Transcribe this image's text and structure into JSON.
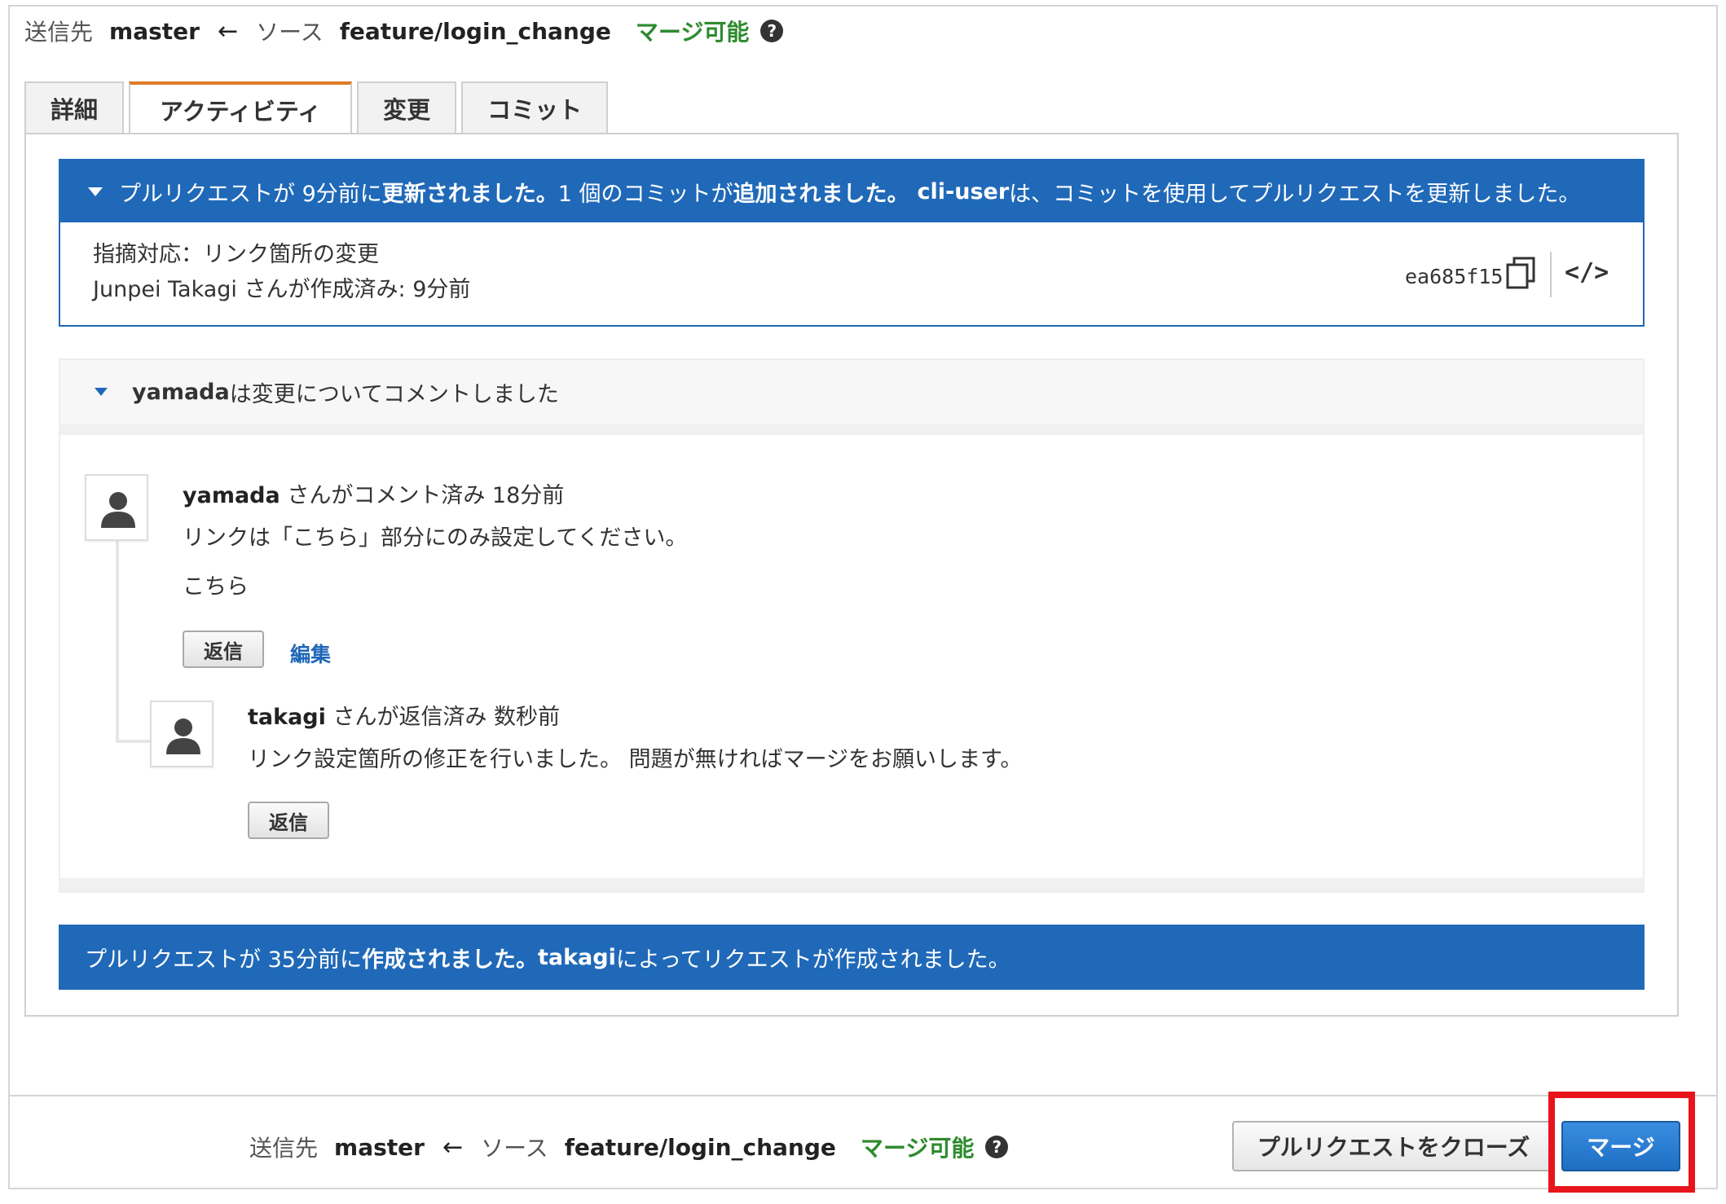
{
  "top_branch": {
    "dest_label": "送信先",
    "dest_branch": "master",
    "arrow": "←",
    "source_label": "ソース",
    "source_branch": "feature/login_change",
    "merge_status": "マージ可能",
    "help": "?"
  },
  "tabs": [
    {
      "label": "詳細"
    },
    {
      "label": "アクティビティ"
    },
    {
      "label": "変更"
    },
    {
      "label": "コミット"
    }
  ],
  "update_event": {
    "part1": "プルリクエストが 9分前に",
    "bold1": "更新されました。",
    "part2": "1 個のコミットが",
    "bold2": "追加されました。",
    "user": "cli-user",
    "part3": " は、コミットを使用してプルリクエストを更新しました。"
  },
  "commit": {
    "message": "指摘対応：リンク箇所の変更",
    "author_line": "Junpei Takagi さんが作成済み: 9分前",
    "hash": "ea685f15",
    "code_icon": "</>"
  },
  "comment_header": {
    "user": "yamada",
    "text": " は変更についてコメントしました"
  },
  "comment1": {
    "user": "yamada",
    "meta": " さんがコメント済み 18分前",
    "body": "リンクは「こちら」部分にのみ設定してください。",
    "body2": "こちら",
    "reply": "返信",
    "edit": "編集"
  },
  "comment2": {
    "user": "takagi",
    "meta": " さんが返信済み 数秒前",
    "body": "リンク設定箇所の修正を行いました。 問題が無ければマージをお願いします。",
    "reply": "返信"
  },
  "create_event": {
    "part1": "プルリクエストが 35分前に",
    "bold1": "作成されました。",
    "user": "takagi",
    "part2": " によってリクエストが作成されました。"
  },
  "bottom_branch": {
    "dest_label": "送信先",
    "dest_branch": "master",
    "arrow": "←",
    "source_label": "ソース",
    "source_branch": "feature/login_change",
    "merge_status": "マージ可能",
    "help": "?"
  },
  "actions": {
    "close_label": "プルリクエストをクローズ",
    "merge_label": "マージ"
  },
  "colors": {
    "event_blue": "#2069b8",
    "merge_ok_green": "#2e8b2e",
    "tab_active_orange": "#e07b26",
    "highlight_red": "#e8141c"
  }
}
